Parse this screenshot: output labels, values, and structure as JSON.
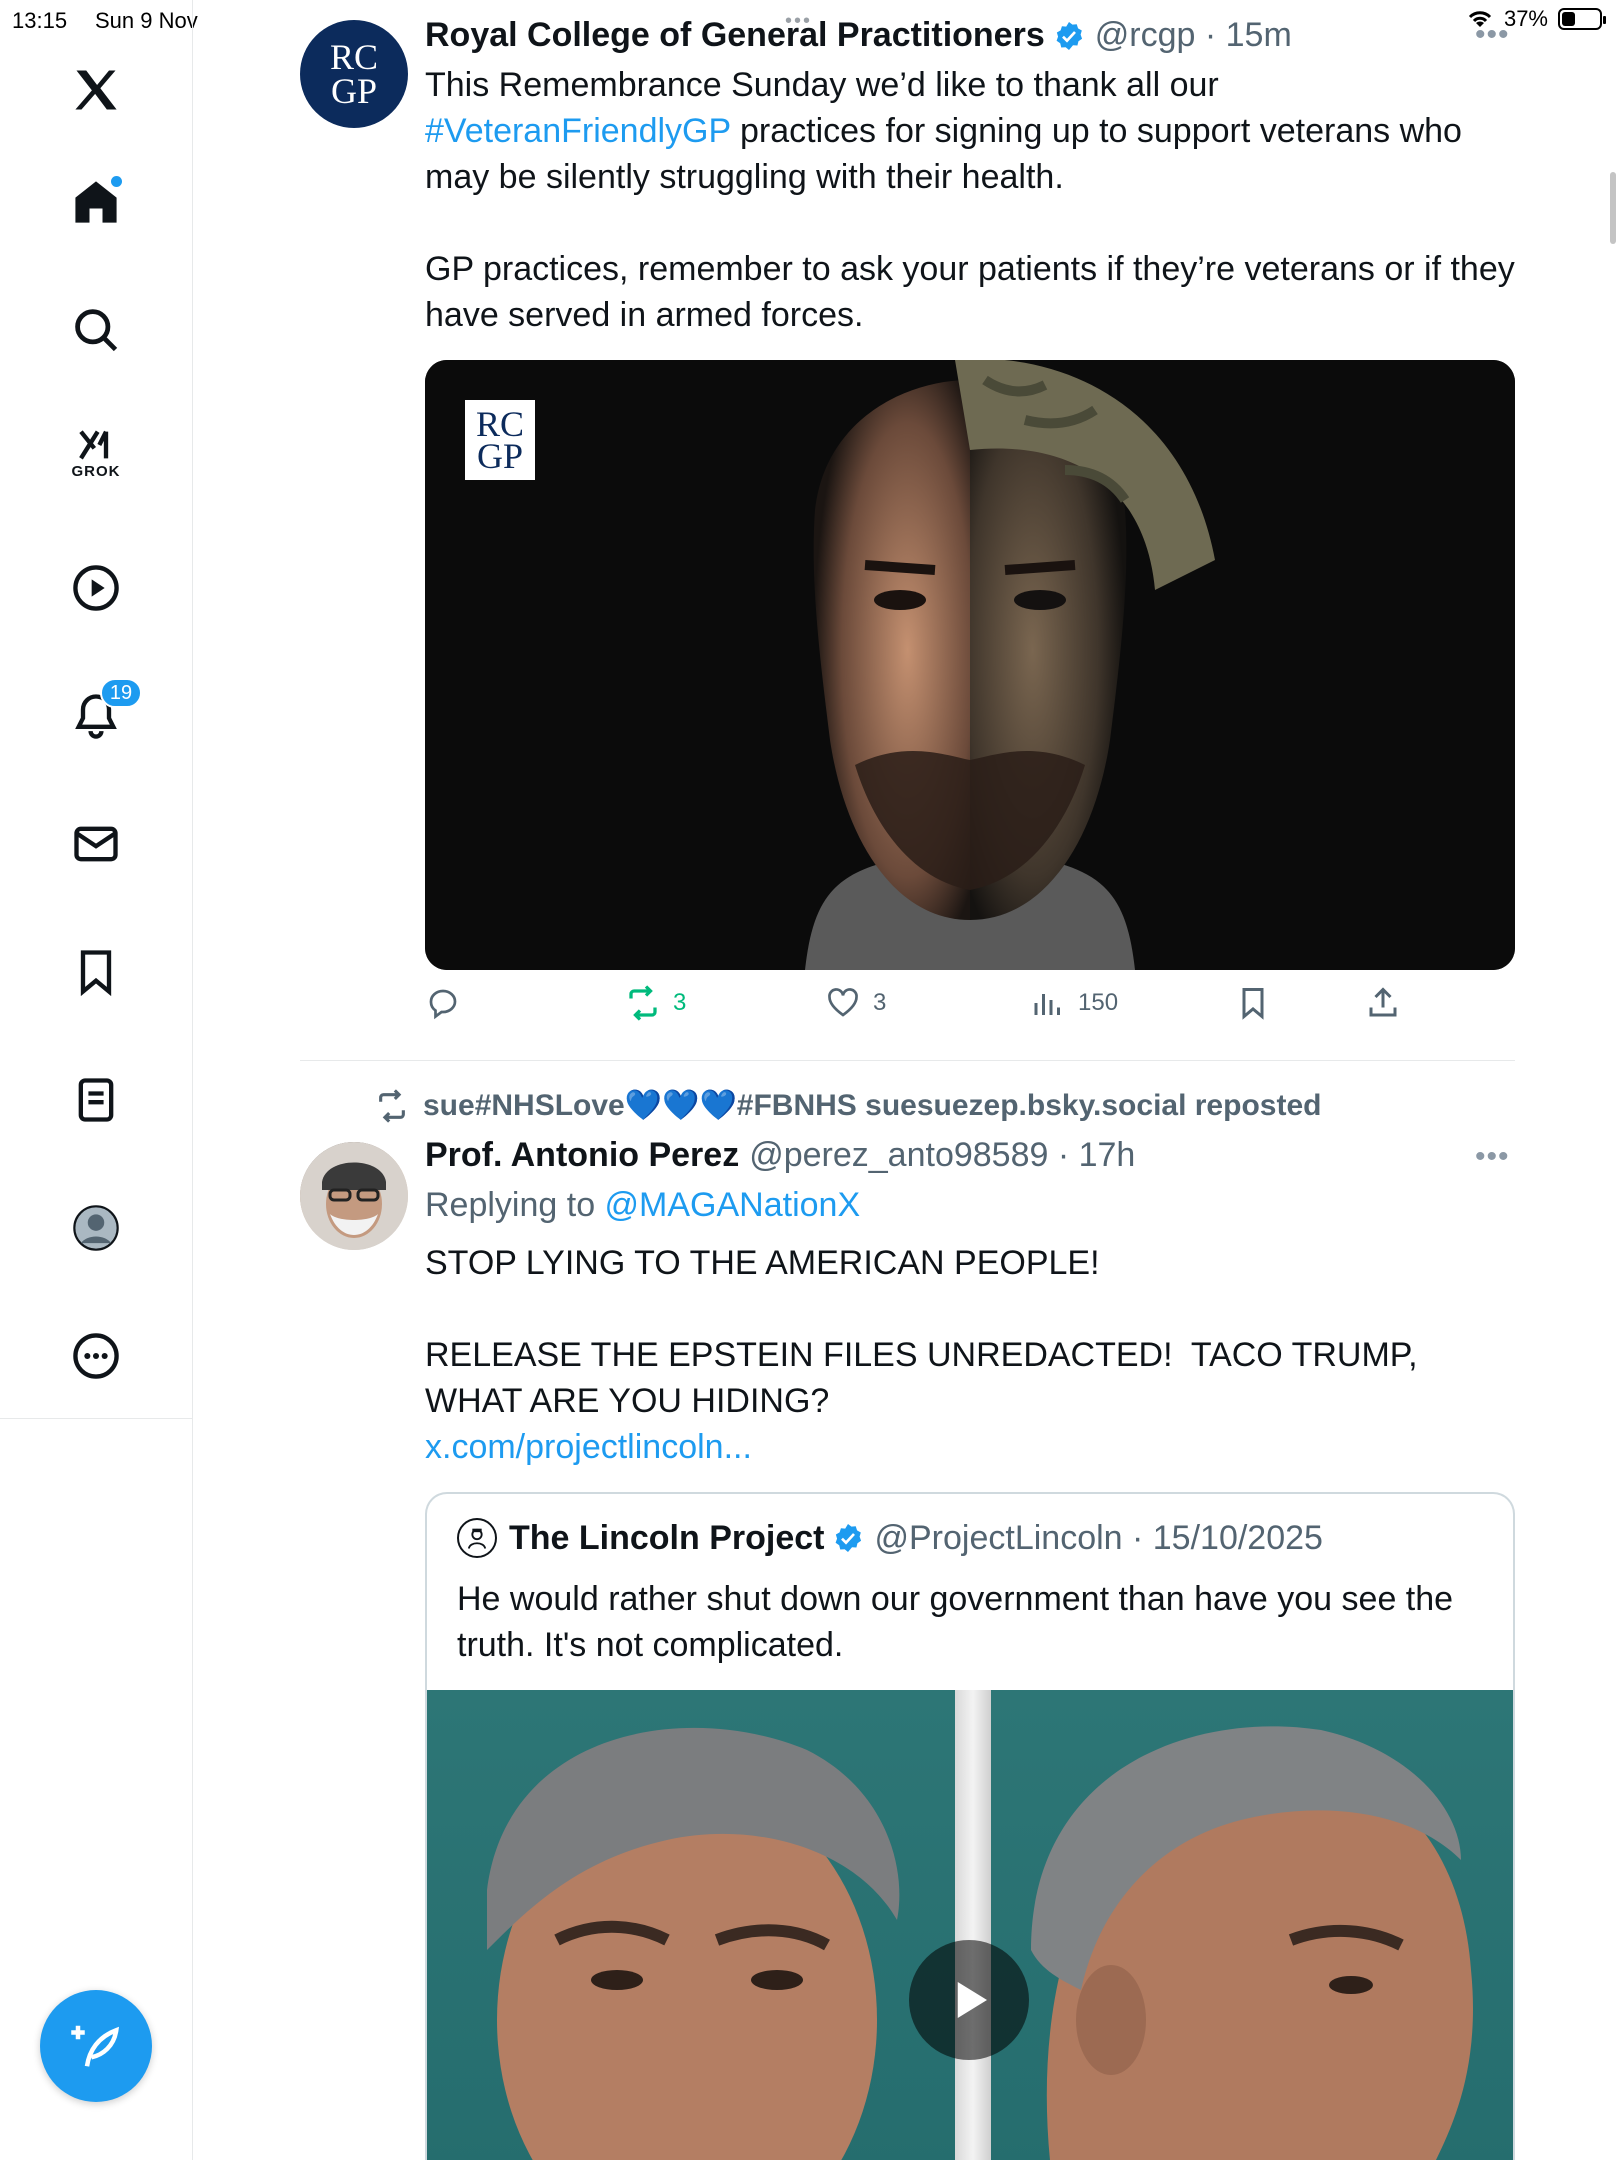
{
  "status_bar": {
    "time": "13:15",
    "date": "Sun 9 Nov",
    "battery_percent": "37%",
    "battery_level": 0.37
  },
  "sidebar": {
    "logo": "x-logo-icon",
    "items": [
      {
        "icon": "home-icon",
        "label": "Home"
      },
      {
        "icon": "search-icon",
        "label": "Search"
      },
      {
        "icon": "grok-icon",
        "label": "GROK"
      },
      {
        "icon": "video-icon",
        "label": "Video"
      },
      {
        "icon": "bell-icon",
        "label": "Notifications",
        "badge": "19"
      },
      {
        "icon": "mail-icon",
        "label": "Messages"
      },
      {
        "icon": "bookmark-icon",
        "label": "Bookmarks"
      },
      {
        "icon": "lists-icon",
        "label": "Lists"
      },
      {
        "icon": "profile-icon",
        "label": "Profile"
      },
      {
        "icon": "more-icon",
        "label": "More"
      }
    ],
    "compose_icon": "compose-icon"
  },
  "tweet1": {
    "avatar_text": [
      "RC",
      "GP"
    ],
    "name": "Royal College of General Practitioners",
    "handle": "@rcgp · 15m",
    "text_before_link": "This Remembrance Sunday we’d like to thank all our ",
    "hashtag": "#VeteranFriendlyGP",
    "text_after_link": " practices for signing up to support veterans who may be silently struggling with their health.\n\nGP practices, remember to ask your patients if they’re veterans or if they have served in armed forces.",
    "media_logo": [
      "RC",
      "GP"
    ],
    "stats": {
      "replies": "",
      "reposts": "3",
      "likes": "3",
      "views": "150"
    }
  },
  "tweet2": {
    "repost_by": "sue#NHSLove💙💙💙#FBNHS suesuezep.bsky.social reposted",
    "name": "Prof. Antonio Perez",
    "handle": "@perez_anto98589 · 17h",
    "replying_label": "Replying to ",
    "replying_to": "@MAGANationX",
    "text": "STOP LYING TO THE AMERICAN PEOPLE!\n\nRELEASE THE EPSTEIN FILES UNREDACTED!  TACO TRUMP, WHAT ARE YOU HIDING?",
    "link": "x.com/projectlincoln...",
    "quote": {
      "name": "The Lincoln Project",
      "handle": "@ProjectLincoln · 15/10/2025",
      "text": "He would rather shut down our government than have you see the truth. It's not complicated."
    }
  },
  "colors": {
    "accent": "#1d9bf0",
    "retweet_green": "#00ba7c",
    "text_primary": "#0f1419",
    "text_secondary": "#536471"
  }
}
